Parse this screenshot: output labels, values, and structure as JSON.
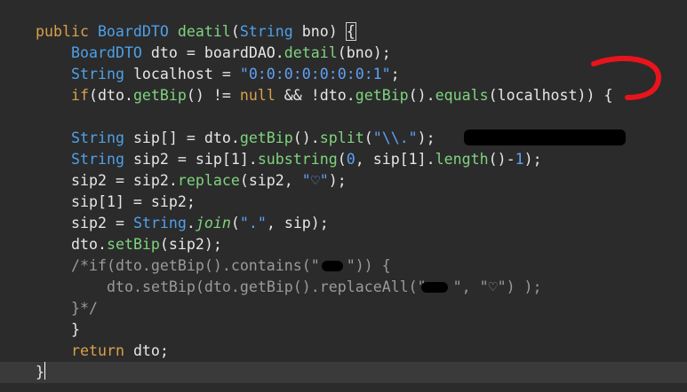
{
  "editor": {
    "lines": [
      {
        "tokens": [
          [
            "kw",
            "public "
          ],
          [
            "ty",
            "BoardDTO "
          ],
          [
            "mth",
            "deatil"
          ],
          [
            "var",
            "("
          ],
          [
            "ty",
            "String "
          ],
          [
            "var",
            "bno) "
          ],
          [
            "box",
            "{"
          ]
        ]
      },
      {
        "tokens": [
          [
            "ty",
            "BoardDTO "
          ],
          [
            "var",
            "dto = "
          ],
          [
            "var",
            "boardDAO."
          ],
          [
            "mth",
            "detail"
          ],
          [
            "var",
            "(bno);"
          ]
        ]
      },
      {
        "tokens": [
          [
            "ty",
            "String "
          ],
          [
            "var",
            "localhost = "
          ],
          [
            "str",
            "\"0:0:0:0:0:0:0:1\""
          ],
          [
            "var",
            ";"
          ]
        ]
      },
      {
        "tokens": [
          [
            "kw",
            "if"
          ],
          [
            "var",
            "(dto."
          ],
          [
            "mth",
            "getBip"
          ],
          [
            "var",
            "() != "
          ],
          [
            "nul",
            "null"
          ],
          [
            "var",
            " && !dto."
          ],
          [
            "mth",
            "getBip"
          ],
          [
            "var",
            "()."
          ],
          [
            "mth",
            "equals"
          ],
          [
            "var",
            "(localhost)) {"
          ]
        ]
      },
      {
        "tokens": []
      },
      {
        "tokens": [
          [
            "ty",
            "String "
          ],
          [
            "var",
            "sip[] = dto."
          ],
          [
            "mth",
            "getBip"
          ],
          [
            "var",
            "()."
          ],
          [
            "mth",
            "split"
          ],
          [
            "var",
            "("
          ],
          [
            "str",
            "\"\\\\.\""
          ],
          [
            "var",
            ");"
          ]
        ]
      },
      {
        "tokens": [
          [
            "ty",
            "String "
          ],
          [
            "var",
            "sip2 = sip[1]."
          ],
          [
            "mth",
            "substring"
          ],
          [
            "var",
            "("
          ],
          [
            "num",
            "0"
          ],
          [
            "var",
            ", sip[1]."
          ],
          [
            "mth",
            "length"
          ],
          [
            "var",
            "()-"
          ],
          [
            "num",
            "1"
          ],
          [
            "var",
            ");"
          ]
        ]
      },
      {
        "tokens": [
          [
            "var",
            "sip2 = sip2."
          ],
          [
            "mth",
            "replace"
          ],
          [
            "var",
            "(sip2, "
          ],
          [
            "str",
            "\"♡\""
          ],
          [
            "var",
            ");"
          ]
        ]
      },
      {
        "tokens": [
          [
            "var",
            "sip[1] = sip2;"
          ]
        ]
      },
      {
        "tokens": [
          [
            "var",
            "sip2 = "
          ],
          [
            "ty",
            "String"
          ],
          [
            "var",
            "."
          ],
          [
            "it",
            "join"
          ],
          [
            "var",
            "("
          ],
          [
            "str",
            "\".\""
          ],
          [
            "var",
            ", sip);"
          ]
        ]
      },
      {
        "tokens": [
          [
            "var",
            "dto."
          ],
          [
            "mth",
            "setBip"
          ],
          [
            "var",
            "(sip2);"
          ]
        ]
      },
      {
        "tokens": [
          [
            "com",
            "/*if(dto.getBip().contains(\"   \")) {"
          ]
        ]
      },
      {
        "tokens": [
          [
            "com",
            "dto.setBip(dto.getBip().replaceAll(\"   \", \"♡\") );"
          ]
        ]
      },
      {
        "tokens": [
          [
            "com",
            "}*/"
          ]
        ]
      },
      {
        "tokens": [
          [
            "var",
            "}"
          ]
        ]
      },
      {
        "tokens": [
          [
            "kw",
            "return "
          ],
          [
            "var",
            "dto;"
          ]
        ]
      },
      {
        "tokens": [
          [
            "var",
            "}"
          ]
        ]
      }
    ],
    "indents": [
      0,
      1,
      1,
      1,
      0,
      1,
      1,
      1,
      1,
      1,
      1,
      1,
      2,
      1,
      1,
      1,
      0
    ]
  },
  "colors": {
    "background": "#2b2b2b",
    "current_line": "#3a3a3a",
    "annotation_red": "#e8141c",
    "redaction": "#000000"
  }
}
